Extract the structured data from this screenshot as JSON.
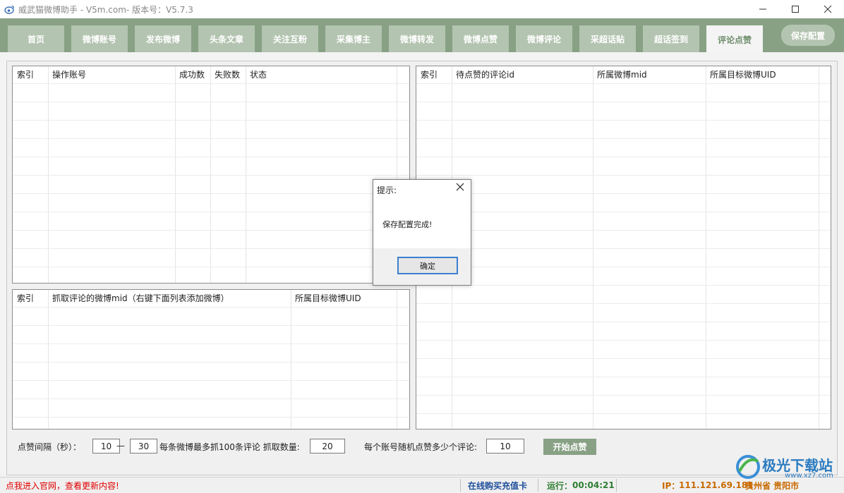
{
  "titlebar": {
    "title": "威武猫微博助手 - V5m.com- 版本号：V5.7.3",
    "icon": "weibo-logo-icon"
  },
  "tabs": [
    {
      "label": "首页"
    },
    {
      "label": "微博账号"
    },
    {
      "label": "发布微博"
    },
    {
      "label": "头条文章"
    },
    {
      "label": "关注互粉"
    },
    {
      "label": "采集博主"
    },
    {
      "label": "微博转发"
    },
    {
      "label": "微博点赞"
    },
    {
      "label": "微博评论"
    },
    {
      "label": "采超话贴"
    },
    {
      "label": "超话签到"
    },
    {
      "label": "评论点赞",
      "active": true
    }
  ],
  "save_config_label": "保存配置",
  "grid_accounts": {
    "columns": [
      "索引",
      "操作账号",
      "成功数",
      "失败数",
      "状态"
    ]
  },
  "grid_comments": {
    "columns": [
      "索引",
      "待点赞的评论id",
      "所属微博mid",
      "所属目标微博UID"
    ]
  },
  "grid_weibo": {
    "columns": [
      "索引",
      "抓取评论的微博mid（右键下面列表添加微博）",
      "所属目标微博UID"
    ]
  },
  "controls": {
    "interval_label": "点赞间隔（秒）：",
    "interval_min": "10",
    "interval_dash": "—",
    "interval_max": "30",
    "fetch_label": "每条微博最多抓100条评论 抓取数量:",
    "fetch_count": "20",
    "per_account_label": "每个账号随机点赞多少个评论:",
    "per_account_count": "10",
    "start_label": "开始点赞"
  },
  "statusbar": {
    "official_link": "点我进入官网，查看更新内容!",
    "buy_card": "在线购买充值卡",
    "runtime_label": "运行：",
    "runtime_value": "00:04:21",
    "ip_label": "IP：",
    "ip_value": "111.121.69.181",
    "location": "贵州省 贵阳市"
  },
  "dialog": {
    "title": "提示:",
    "message": "保存配置完成!",
    "ok_label": "确定"
  },
  "watermark": {
    "text": "极光下载站",
    "url": "www.xz7.com"
  },
  "colors": {
    "tabbar": "#88a185",
    "tab": "#b3c4b0",
    "active_tab_text": "#6f8d6b",
    "link_red": "#e00000",
    "status_blue": "#1f4e9c",
    "status_green": "#2e7d32",
    "status_orange": "#c96a00"
  }
}
